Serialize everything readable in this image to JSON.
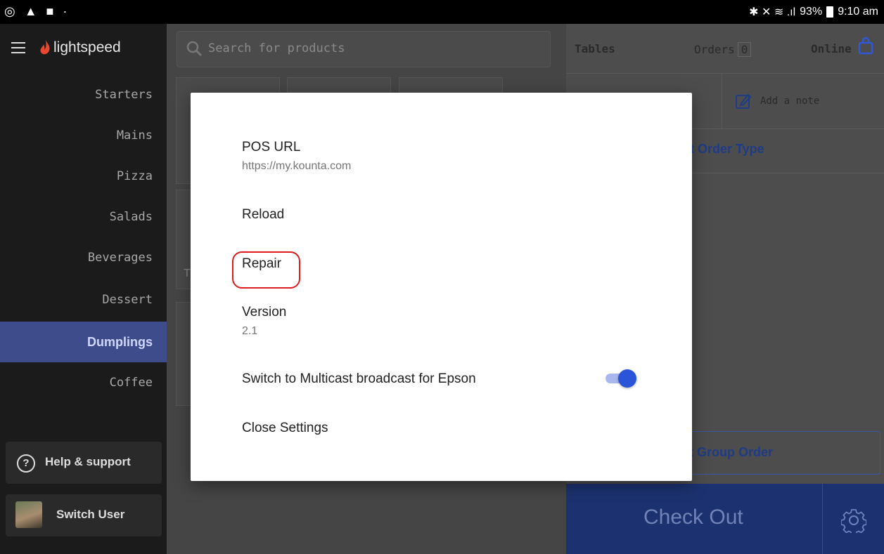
{
  "status_bar": {
    "left_icons": "◎ ▲ ■ ·",
    "right_icons": "✱ ✕ ≋ .ıl",
    "battery": "93%",
    "time": "9:10 am"
  },
  "sidebar": {
    "logo": "lightspeed",
    "categories": [
      "Starters",
      "Mains",
      "Pizza",
      "Salads",
      "Beverages",
      "Dessert",
      "Dumplings",
      "Coffee"
    ],
    "active_category": "Dumplings",
    "help_label": "Help & support",
    "switch_user_label": "Switch User"
  },
  "center": {
    "search_placeholder": "Search for products",
    "partial_tile_text": "T"
  },
  "right_panel": {
    "tables_label": "Tables",
    "orders_label": "Orders",
    "orders_count": "0",
    "online_label": "Online",
    "add_note_label": "Add a note",
    "order_type_label": "t Order Type",
    "group_order_label": "t Group Order",
    "checkout_label": "Check Out",
    "accent_color": "#1c3270"
  },
  "settings_modal": {
    "pos_url_label": "POS URL",
    "pos_url_value": "https://my.kounta.com",
    "reload_label": "Reload",
    "repair_label": "Repair",
    "version_label": "Version",
    "version_value": "2.1",
    "multicast_label": "Switch to Multicast broadcast for Epson",
    "multicast_enabled": true,
    "close_label": "Close Settings",
    "highlight_color": "#e01b1b"
  }
}
